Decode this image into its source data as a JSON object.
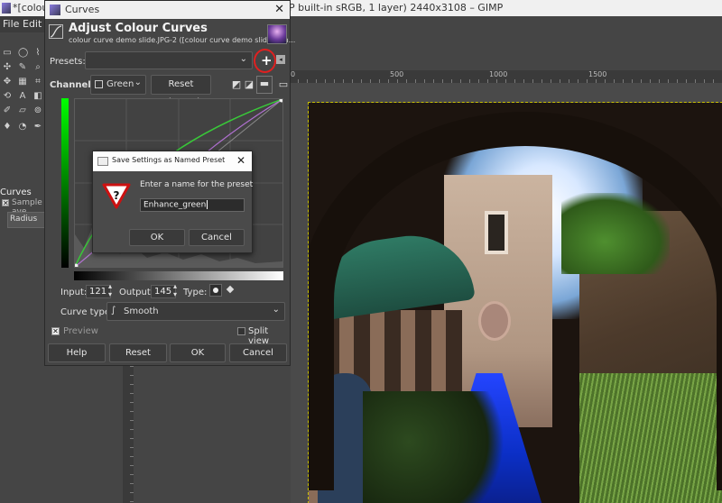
{
  "main_window": {
    "title_left": "*[colour",
    "title_right": "P built-in sRGB, 1 layer) 2440x3108 – GIMP",
    "menu": [
      "File",
      "Edit"
    ]
  },
  "toolbox": {
    "panel_title": "Curves",
    "sample_label": "Sample ave",
    "radius_label": "Radius"
  },
  "rulers": {
    "top_marks": [
      "0",
      "500",
      "1000",
      "1500"
    ]
  },
  "curves_dialog": {
    "title": "Curves",
    "heading": "Adjust Colour Curves",
    "subtitle": "colour curve demo slide.JPG-2 ([colour curve demo slide] (im...",
    "presets_label": "Presets:",
    "presets_value": "",
    "channel_label": "Channel:",
    "channel_value": "Green",
    "reset_channel": "Reset Channel",
    "input_label": "Input:",
    "input_value": "121",
    "output_label": "Output:",
    "output_value": "145",
    "type_label": "Type:",
    "curve_type_label": "Curve type:",
    "curve_type_value": "Smooth",
    "preview_label": "Preview",
    "preview_checked": true,
    "split_view_label": "Split view",
    "split_view_checked": false,
    "buttons": {
      "help": "Help",
      "reset": "Reset",
      "ok": "OK",
      "cancel": "Cancel"
    }
  },
  "save_preset_dialog": {
    "title": "Save Settings as Named Preset",
    "prompt": "Enter a name for the preset",
    "value": "Enhance_green",
    "ok": "OK",
    "cancel": "Cancel"
  },
  "colors": {
    "highlight_circle": "#e02020",
    "green_curve": "#39c839",
    "purple_curve": "#b070d0",
    "selection_border": "#c8c000"
  }
}
